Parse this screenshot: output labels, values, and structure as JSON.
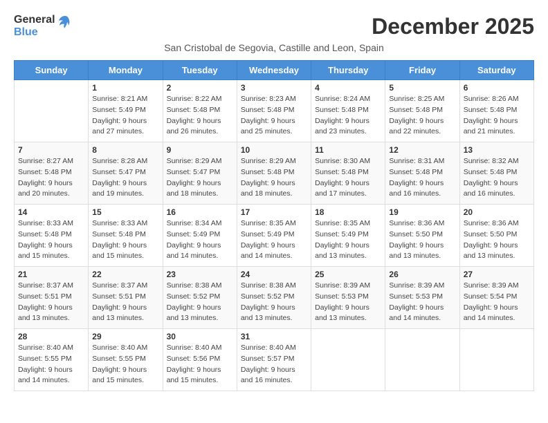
{
  "logo": {
    "general": "General",
    "blue": "Blue"
  },
  "title": "December 2025",
  "subtitle": "San Cristobal de Segovia, Castille and Leon, Spain",
  "weekdays": [
    "Sunday",
    "Monday",
    "Tuesday",
    "Wednesday",
    "Thursday",
    "Friday",
    "Saturday"
  ],
  "weeks": [
    [
      {
        "day": "",
        "info": ""
      },
      {
        "day": "1",
        "info": "Sunrise: 8:21 AM\nSunset: 5:49 PM\nDaylight: 9 hours\nand 27 minutes."
      },
      {
        "day": "2",
        "info": "Sunrise: 8:22 AM\nSunset: 5:48 PM\nDaylight: 9 hours\nand 26 minutes."
      },
      {
        "day": "3",
        "info": "Sunrise: 8:23 AM\nSunset: 5:48 PM\nDaylight: 9 hours\nand 25 minutes."
      },
      {
        "day": "4",
        "info": "Sunrise: 8:24 AM\nSunset: 5:48 PM\nDaylight: 9 hours\nand 23 minutes."
      },
      {
        "day": "5",
        "info": "Sunrise: 8:25 AM\nSunset: 5:48 PM\nDaylight: 9 hours\nand 22 minutes."
      },
      {
        "day": "6",
        "info": "Sunrise: 8:26 AM\nSunset: 5:48 PM\nDaylight: 9 hours\nand 21 minutes."
      }
    ],
    [
      {
        "day": "7",
        "info": "Sunrise: 8:27 AM\nSunset: 5:48 PM\nDaylight: 9 hours\nand 20 minutes."
      },
      {
        "day": "8",
        "info": "Sunrise: 8:28 AM\nSunset: 5:47 PM\nDaylight: 9 hours\nand 19 minutes."
      },
      {
        "day": "9",
        "info": "Sunrise: 8:29 AM\nSunset: 5:47 PM\nDaylight: 9 hours\nand 18 minutes."
      },
      {
        "day": "10",
        "info": "Sunrise: 8:29 AM\nSunset: 5:48 PM\nDaylight: 9 hours\nand 18 minutes."
      },
      {
        "day": "11",
        "info": "Sunrise: 8:30 AM\nSunset: 5:48 PM\nDaylight: 9 hours\nand 17 minutes."
      },
      {
        "day": "12",
        "info": "Sunrise: 8:31 AM\nSunset: 5:48 PM\nDaylight: 9 hours\nand 16 minutes."
      },
      {
        "day": "13",
        "info": "Sunrise: 8:32 AM\nSunset: 5:48 PM\nDaylight: 9 hours\nand 16 minutes."
      }
    ],
    [
      {
        "day": "14",
        "info": "Sunrise: 8:33 AM\nSunset: 5:48 PM\nDaylight: 9 hours\nand 15 minutes."
      },
      {
        "day": "15",
        "info": "Sunrise: 8:33 AM\nSunset: 5:48 PM\nDaylight: 9 hours\nand 15 minutes."
      },
      {
        "day": "16",
        "info": "Sunrise: 8:34 AM\nSunset: 5:49 PM\nDaylight: 9 hours\nand 14 minutes."
      },
      {
        "day": "17",
        "info": "Sunrise: 8:35 AM\nSunset: 5:49 PM\nDaylight: 9 hours\nand 14 minutes."
      },
      {
        "day": "18",
        "info": "Sunrise: 8:35 AM\nSunset: 5:49 PM\nDaylight: 9 hours\nand 13 minutes."
      },
      {
        "day": "19",
        "info": "Sunrise: 8:36 AM\nSunset: 5:50 PM\nDaylight: 9 hours\nand 13 minutes."
      },
      {
        "day": "20",
        "info": "Sunrise: 8:36 AM\nSunset: 5:50 PM\nDaylight: 9 hours\nand 13 minutes."
      }
    ],
    [
      {
        "day": "21",
        "info": "Sunrise: 8:37 AM\nSunset: 5:51 PM\nDaylight: 9 hours\nand 13 minutes."
      },
      {
        "day": "22",
        "info": "Sunrise: 8:37 AM\nSunset: 5:51 PM\nDaylight: 9 hours\nand 13 minutes."
      },
      {
        "day": "23",
        "info": "Sunrise: 8:38 AM\nSunset: 5:52 PM\nDaylight: 9 hours\nand 13 minutes."
      },
      {
        "day": "24",
        "info": "Sunrise: 8:38 AM\nSunset: 5:52 PM\nDaylight: 9 hours\nand 13 minutes."
      },
      {
        "day": "25",
        "info": "Sunrise: 8:39 AM\nSunset: 5:53 PM\nDaylight: 9 hours\nand 13 minutes."
      },
      {
        "day": "26",
        "info": "Sunrise: 8:39 AM\nSunset: 5:53 PM\nDaylight: 9 hours\nand 14 minutes."
      },
      {
        "day": "27",
        "info": "Sunrise: 8:39 AM\nSunset: 5:54 PM\nDaylight: 9 hours\nand 14 minutes."
      }
    ],
    [
      {
        "day": "28",
        "info": "Sunrise: 8:40 AM\nSunset: 5:55 PM\nDaylight: 9 hours\nand 14 minutes."
      },
      {
        "day": "29",
        "info": "Sunrise: 8:40 AM\nSunset: 5:55 PM\nDaylight: 9 hours\nand 15 minutes."
      },
      {
        "day": "30",
        "info": "Sunrise: 8:40 AM\nSunset: 5:56 PM\nDaylight: 9 hours\nand 15 minutes."
      },
      {
        "day": "31",
        "info": "Sunrise: 8:40 AM\nSunset: 5:57 PM\nDaylight: 9 hours\nand 16 minutes."
      },
      {
        "day": "",
        "info": ""
      },
      {
        "day": "",
        "info": ""
      },
      {
        "day": "",
        "info": ""
      }
    ]
  ]
}
